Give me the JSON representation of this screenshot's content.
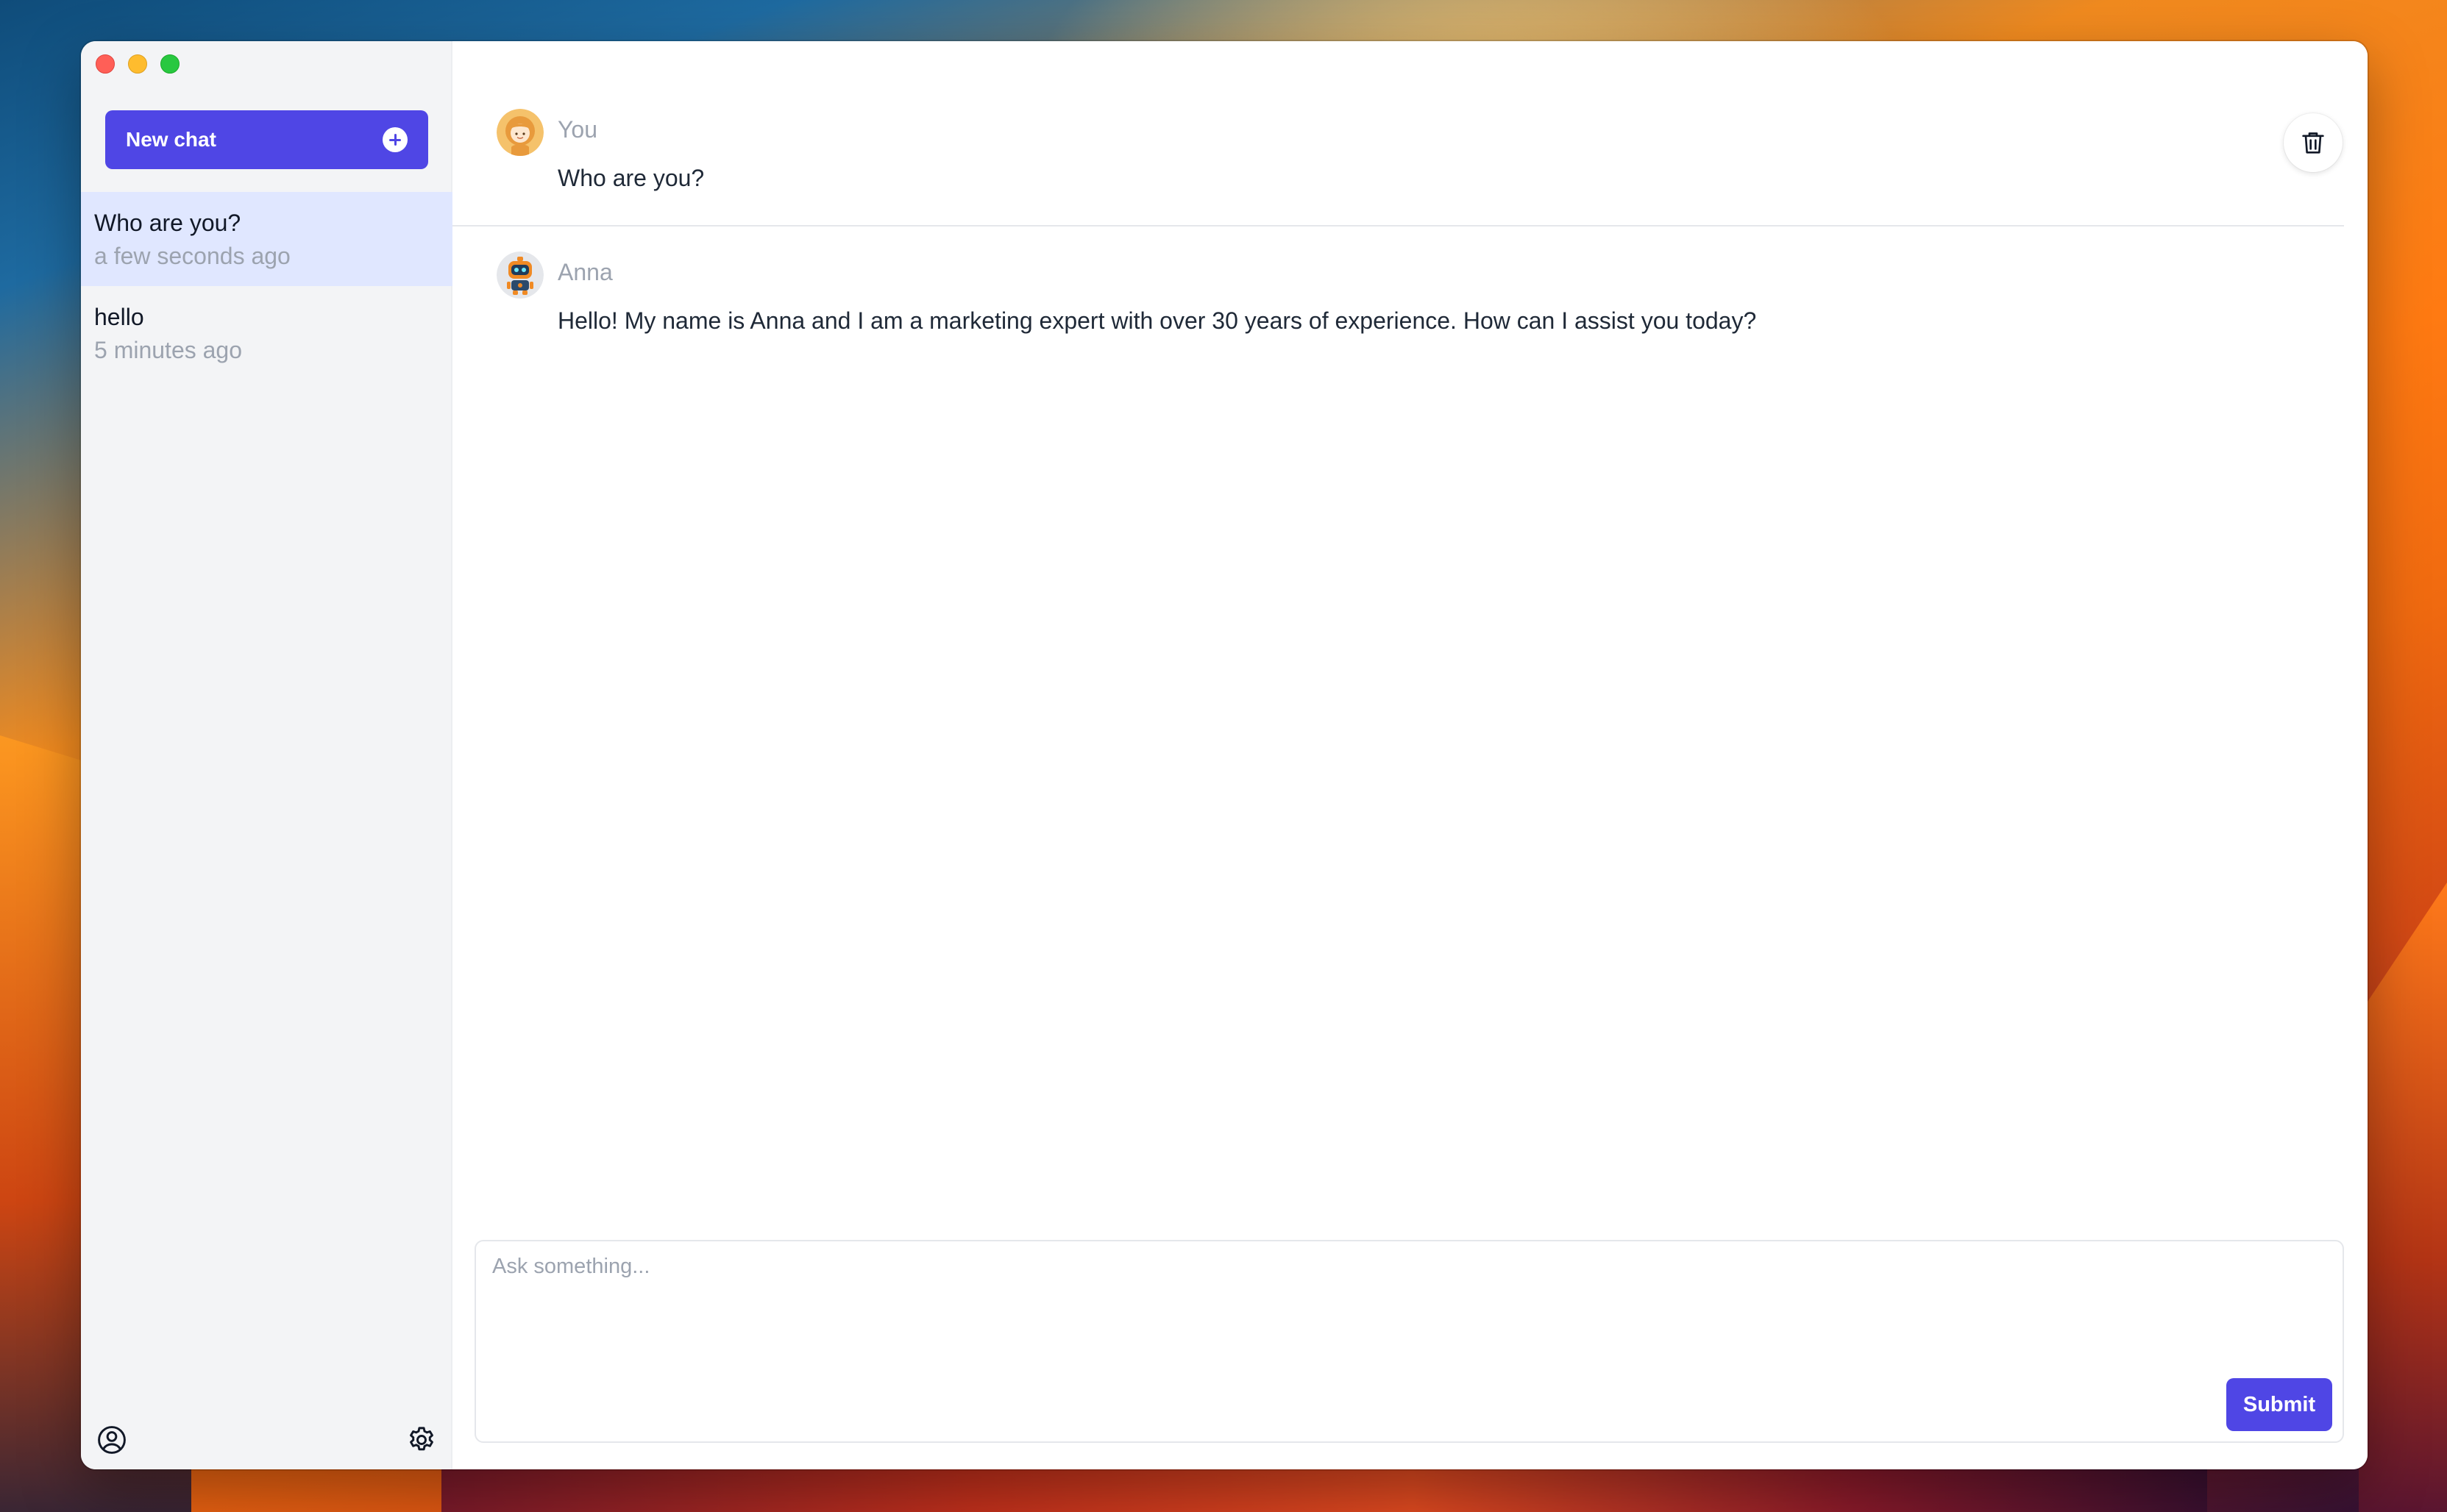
{
  "sidebar": {
    "new_chat_label": "New chat",
    "conversations": [
      {
        "title": "Who are you?",
        "time": "a few seconds ago",
        "active": true
      },
      {
        "title": "hello",
        "time": "5 minutes ago",
        "active": false
      }
    ],
    "footer_icons": [
      "user-circle-icon",
      "gear-icon"
    ]
  },
  "messages": [
    {
      "sender": "You",
      "text": "Who are you?",
      "avatar": "girl-avatar"
    },
    {
      "sender": "Anna",
      "text": "Hello! My name is Anna and I am a marketing expert with over 30 years of experience. How can I assist you today?",
      "avatar": "robot-avatar"
    }
  ],
  "composer": {
    "placeholder": "Ask something...",
    "submit_label": "Submit"
  },
  "toolbar": {
    "delete_icon": "trash-icon"
  },
  "colors": {
    "accent": "#4f46e5",
    "sidebar_bg": "#f3f4f6",
    "active_item_bg": "#e0e7ff",
    "muted_text": "#9ca3af"
  }
}
